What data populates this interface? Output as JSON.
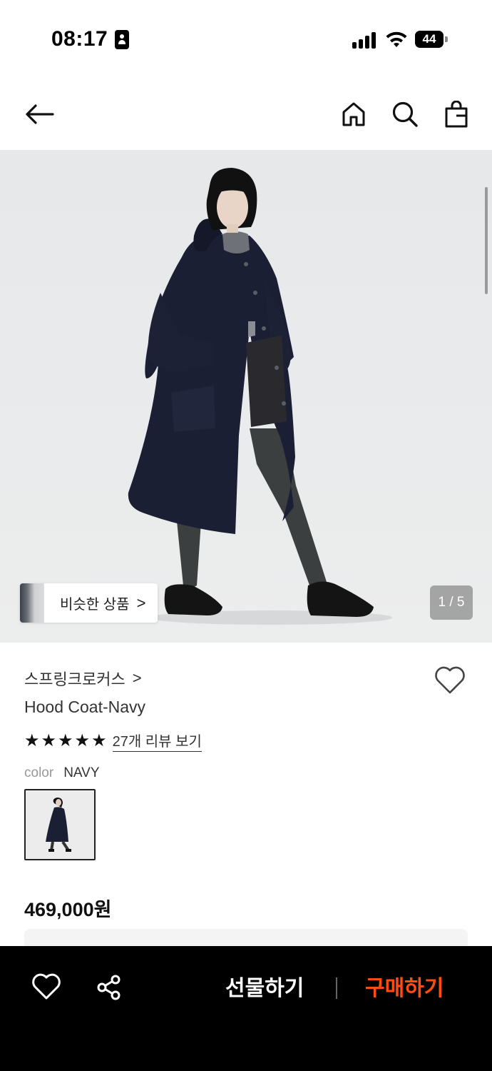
{
  "status_bar": {
    "time": "08:17",
    "battery": "44"
  },
  "nav": {
    "icons": [
      "arrow-left-icon",
      "home-icon",
      "search-icon",
      "shopping-bag-icon"
    ]
  },
  "gallery": {
    "similar_products_label": "비슷한 상품",
    "similar_chevron": ">",
    "page_indicator": "1 / 5"
  },
  "product": {
    "brand": "스프링크로커스",
    "brand_chevron": ">",
    "name": "Hood Coat-Navy",
    "rating_stars": 5,
    "review_link": "27개 리뷰 보기",
    "color_label": "color",
    "color_value": "NAVY",
    "price": "469,000원"
  },
  "bottom_bar": {
    "gift_label": "선물하기",
    "buy_label": "구매하기",
    "buy_color": "#ff4d12"
  }
}
